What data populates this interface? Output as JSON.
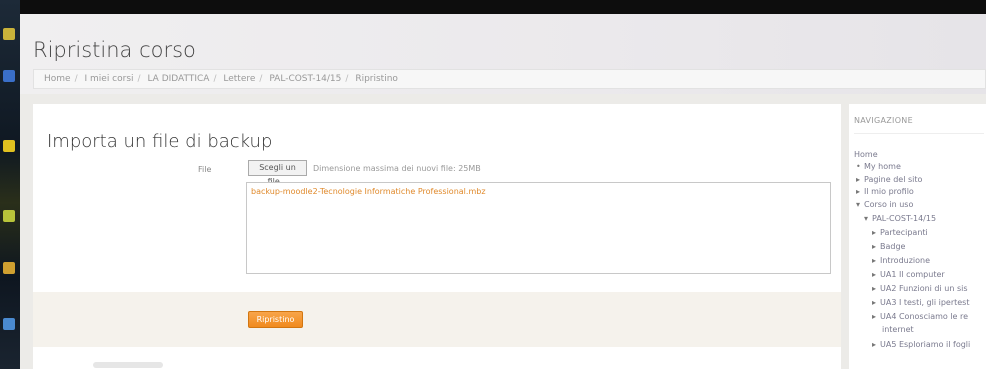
{
  "page_title": "Ripristina corso",
  "breadcrumb": [
    "Home",
    "I miei corsi",
    "LA DIDATTICA",
    "Lettere",
    "PAL-COST-14/15",
    "Ripristino"
  ],
  "backup": {
    "section_title": "Importa un file di backup",
    "file_label": "File",
    "choose_button": "Scegli un file...",
    "max_size": "Dimensione massima dei nuovi file: 25MB",
    "selected_file": "backup-moodle2-Tecnologie Informatiche Professional.mbz",
    "restore_button": "Ripristino"
  },
  "navigation": {
    "header": "NAVIGAZIONE",
    "home": "Home",
    "items": [
      {
        "label": "My home",
        "bullet": "•"
      },
      {
        "label": "Pagine del sito",
        "bullet": "▸"
      },
      {
        "label": "Il mio profilo",
        "bullet": "▸"
      },
      {
        "label": "Corso in uso",
        "bullet": "▾"
      },
      {
        "label": "PAL-COST-14/15",
        "bullet": "▾"
      },
      {
        "label": "Partecipanti",
        "bullet": "▸"
      },
      {
        "label": "Badge",
        "bullet": "▸"
      },
      {
        "label": "Introduzione",
        "bullet": "▸"
      },
      {
        "label": "UA1 Il computer",
        "bullet": "▸"
      },
      {
        "label": "UA2 Funzioni di un sis",
        "bullet": "▸"
      },
      {
        "label": "UA3 I testi, gli ipertest",
        "bullet": "▸"
      },
      {
        "label": "UA4 Conosciamo le re",
        "bullet": "▸"
      },
      {
        "label": "internet",
        "bullet": ""
      },
      {
        "label": "UA5 Esploriamo il fogli",
        "bullet": "▸"
      }
    ]
  },
  "colors": {
    "accent": "#f08a1e",
    "file_text": "#e08a2c"
  }
}
